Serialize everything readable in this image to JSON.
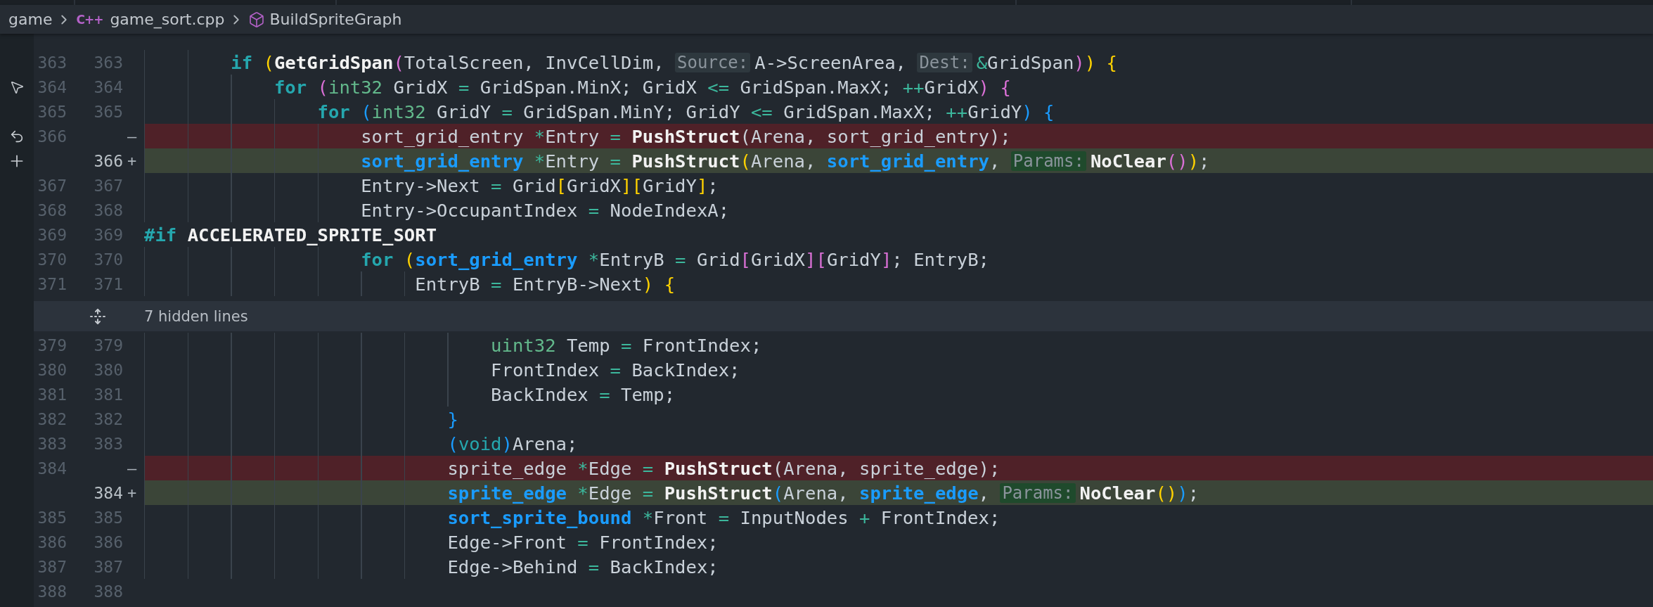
{
  "breadcrumb": [
    {
      "kind": "folder",
      "label": "game"
    },
    {
      "kind": "file",
      "icon_text": "C++",
      "label": "game_sort.cpp"
    },
    {
      "kind": "symbol",
      "label": "BuildSpriteGraph"
    }
  ],
  "rows": [
    {
      "kind": "line",
      "old": "363",
      "new": "363",
      "tokens": [
        {
          "kind": "control",
          "text": "        if "
        },
        {
          "kind": "b1",
          "text": "("
        },
        {
          "kind": "func",
          "text": "GetGridSpan"
        },
        {
          "kind": "b2",
          "text": "("
        },
        {
          "kind": "text",
          "text": "TotalScreen, InvCellDim, "
        },
        {
          "kind": "hint",
          "text": "Source:"
        },
        {
          "kind": "text",
          "text": "A->ScreenArea, "
        },
        {
          "kind": "hint",
          "text": "Dest:"
        },
        {
          "kind": "op",
          "text": "&"
        },
        {
          "kind": "text",
          "text": "GridSpan"
        },
        {
          "kind": "b2",
          "text": ")"
        },
        {
          "kind": "b1",
          "text": ") "
        },
        {
          "kind": "b1",
          "text": "{"
        }
      ]
    },
    {
      "kind": "line",
      "old": "364",
      "new": "364",
      "gutter": {
        "kind": "pointer"
      },
      "tokens": [
        {
          "kind": "control",
          "text": "            for "
        },
        {
          "kind": "b2",
          "text": "("
        },
        {
          "kind": "builtin",
          "text": "int32"
        },
        {
          "kind": "text",
          "text": " GridX "
        },
        {
          "kind": "op",
          "text": "="
        },
        {
          "kind": "text",
          "text": " GridSpan.MinX; GridX "
        },
        {
          "kind": "op",
          "text": "<="
        },
        {
          "kind": "text",
          "text": " GridSpan.MaxX; "
        },
        {
          "kind": "op",
          "text": "++"
        },
        {
          "kind": "text",
          "text": "GridX"
        },
        {
          "kind": "b2",
          "text": ") "
        },
        {
          "kind": "b2",
          "text": "{"
        }
      ]
    },
    {
      "kind": "line",
      "old": "365",
      "new": "365",
      "tokens": [
        {
          "kind": "control",
          "text": "                for "
        },
        {
          "kind": "b3",
          "text": "("
        },
        {
          "kind": "builtin",
          "text": "int32"
        },
        {
          "kind": "text",
          "text": " GridY "
        },
        {
          "kind": "op",
          "text": "="
        },
        {
          "kind": "text",
          "text": " GridSpan.MinY; GridY "
        },
        {
          "kind": "op",
          "text": "<="
        },
        {
          "kind": "text",
          "text": " GridSpan.MaxX; "
        },
        {
          "kind": "op",
          "text": "++"
        },
        {
          "kind": "text",
          "text": "GridY"
        },
        {
          "kind": "b3",
          "text": ") "
        },
        {
          "kind": "b3",
          "text": "{"
        }
      ]
    },
    {
      "kind": "removed",
      "old": "366",
      "marker": "—",
      "gutter": {
        "kind": "revert"
      },
      "tokens": [
        {
          "kind": "text",
          "text": "                    sort_grid_entry "
        },
        {
          "kind": "op",
          "text": "*"
        },
        {
          "kind": "text",
          "text": "Entry "
        },
        {
          "kind": "op",
          "text": "= "
        },
        {
          "kind": "func",
          "text": "PushStruct"
        },
        {
          "kind": "text",
          "text": "(Arena, sort_grid_entry);"
        }
      ]
    },
    {
      "kind": "added",
      "new": "366",
      "marker": "+",
      "gutter": {
        "kind": "stage"
      },
      "tokens": [
        {
          "kind": "type",
          "text": "                    sort_grid_entry "
        },
        {
          "kind": "op",
          "text": "*"
        },
        {
          "kind": "text",
          "text": "Entry "
        },
        {
          "kind": "op",
          "text": "= "
        },
        {
          "kind": "func",
          "text": "PushStruct"
        },
        {
          "kind": "b1",
          "text": "("
        },
        {
          "kind": "text",
          "text": "Arena, "
        },
        {
          "kind": "type",
          "text": "sort_grid_entry"
        },
        {
          "kind": "text",
          "text": ", "
        },
        {
          "kind": "hint",
          "text": "Params:"
        },
        {
          "kind": "func",
          "text": "NoClear"
        },
        {
          "kind": "b2",
          "text": "("
        },
        {
          "kind": "b2",
          "text": ")"
        },
        {
          "kind": "b1",
          "text": ")"
        },
        {
          "kind": "text",
          "text": ";"
        }
      ]
    },
    {
      "kind": "line",
      "old": "367",
      "new": "367",
      "tokens": [
        {
          "kind": "text",
          "text": "                    Entry->Next "
        },
        {
          "kind": "op",
          "text": "="
        },
        {
          "kind": "text",
          "text": " Grid"
        },
        {
          "kind": "b1",
          "text": "["
        },
        {
          "kind": "text",
          "text": "GridX"
        },
        {
          "kind": "b1",
          "text": "]"
        },
        {
          "kind": "b1",
          "text": "["
        },
        {
          "kind": "text",
          "text": "GridY"
        },
        {
          "kind": "b1",
          "text": "]"
        },
        {
          "kind": "text",
          "text": ";"
        }
      ]
    },
    {
      "kind": "line",
      "old": "368",
      "new": "368",
      "tokens": [
        {
          "kind": "text",
          "text": "                    Entry->OccupantIndex "
        },
        {
          "kind": "op",
          "text": "="
        },
        {
          "kind": "text",
          "text": " NodeIndexA;"
        }
      ]
    },
    {
      "kind": "line",
      "old": "369",
      "new": "369",
      "tokens": [
        {
          "kind": "control",
          "text": "#if "
        },
        {
          "kind": "macro",
          "text": "ACCELERATED_SPRITE_SORT"
        }
      ]
    },
    {
      "kind": "line",
      "old": "370",
      "new": "370",
      "tokens": [
        {
          "kind": "control",
          "text": "                    for "
        },
        {
          "kind": "b1",
          "text": "("
        },
        {
          "kind": "type",
          "text": "sort_grid_entry "
        },
        {
          "kind": "op",
          "text": "*"
        },
        {
          "kind": "text",
          "text": "EntryB "
        },
        {
          "kind": "op",
          "text": "="
        },
        {
          "kind": "text",
          "text": " Grid"
        },
        {
          "kind": "b2",
          "text": "["
        },
        {
          "kind": "text",
          "text": "GridX"
        },
        {
          "kind": "b2",
          "text": "]"
        },
        {
          "kind": "b2",
          "text": "["
        },
        {
          "kind": "text",
          "text": "GridY"
        },
        {
          "kind": "b2",
          "text": "]"
        },
        {
          "kind": "text",
          "text": "; EntryB;"
        }
      ]
    },
    {
      "kind": "line",
      "old": "371",
      "new": "371",
      "tokens": [
        {
          "kind": "text",
          "text": "                         EntryB "
        },
        {
          "kind": "op",
          "text": "="
        },
        {
          "kind": "text",
          "text": " EntryB->Next"
        },
        {
          "kind": "b1",
          "text": ") "
        },
        {
          "kind": "b1",
          "text": "{"
        }
      ]
    },
    {
      "kind": "fold",
      "label": "7 hidden lines"
    },
    {
      "kind": "line",
      "old": "379",
      "new": "379",
      "tokens": [
        {
          "kind": "builtin",
          "text": "                                uint32"
        },
        {
          "kind": "text",
          "text": " Temp "
        },
        {
          "kind": "op",
          "text": "="
        },
        {
          "kind": "text",
          "text": " FrontIndex;"
        }
      ]
    },
    {
      "kind": "line",
      "old": "380",
      "new": "380",
      "tokens": [
        {
          "kind": "text",
          "text": "                                FrontIndex "
        },
        {
          "kind": "op",
          "text": "="
        },
        {
          "kind": "text",
          "text": " BackIndex;"
        }
      ]
    },
    {
      "kind": "line",
      "old": "381",
      "new": "381",
      "tokens": [
        {
          "kind": "text",
          "text": "                                BackIndex "
        },
        {
          "kind": "op",
          "text": "="
        },
        {
          "kind": "text",
          "text": " Temp;"
        }
      ]
    },
    {
      "kind": "line",
      "old": "382",
      "new": "382",
      "tokens": [
        {
          "kind": "b3",
          "text": "                            }"
        }
      ]
    },
    {
      "kind": "line",
      "old": "383",
      "new": "383",
      "tokens": [
        {
          "kind": "b3",
          "text": "                            ("
        },
        {
          "kind": "keyword",
          "text": "void"
        },
        {
          "kind": "b3",
          "text": ")"
        },
        {
          "kind": "text",
          "text": "Arena;"
        }
      ]
    },
    {
      "kind": "removed",
      "old": "384",
      "marker": "—",
      "tokens": [
        {
          "kind": "text",
          "text": "                            sprite_edge "
        },
        {
          "kind": "op",
          "text": "*"
        },
        {
          "kind": "text",
          "text": "Edge "
        },
        {
          "kind": "op",
          "text": "= "
        },
        {
          "kind": "func",
          "text": "PushStruct"
        },
        {
          "kind": "text",
          "text": "(Arena, sprite_edge);"
        }
      ]
    },
    {
      "kind": "added",
      "new": "384",
      "marker": "+",
      "tokens": [
        {
          "kind": "type",
          "text": "                            sprite_edge "
        },
        {
          "kind": "op",
          "text": "*"
        },
        {
          "kind": "text",
          "text": "Edge "
        },
        {
          "kind": "op",
          "text": "= "
        },
        {
          "kind": "func",
          "text": "PushStruct"
        },
        {
          "kind": "b3",
          "text": "("
        },
        {
          "kind": "text",
          "text": "Arena, "
        },
        {
          "kind": "type",
          "text": "sprite_edge"
        },
        {
          "kind": "text",
          "text": ", "
        },
        {
          "kind": "hint",
          "text": "Params:"
        },
        {
          "kind": "func",
          "text": "NoClear"
        },
        {
          "kind": "b1",
          "text": "("
        },
        {
          "kind": "b1",
          "text": ")"
        },
        {
          "kind": "b3",
          "text": ")"
        },
        {
          "kind": "text",
          "text": ";"
        }
      ]
    },
    {
      "kind": "line",
      "old": "385",
      "new": "385",
      "tokens": [
        {
          "kind": "type",
          "text": "                            sort_sprite_bound "
        },
        {
          "kind": "op",
          "text": "*"
        },
        {
          "kind": "text",
          "text": "Front "
        },
        {
          "kind": "op",
          "text": "="
        },
        {
          "kind": "text",
          "text": " InputNodes "
        },
        {
          "kind": "op",
          "text": "+"
        },
        {
          "kind": "text",
          "text": " FrontIndex;"
        }
      ]
    },
    {
      "kind": "line",
      "old": "386",
      "new": "386",
      "tokens": [
        {
          "kind": "text",
          "text": "                            Edge->Front "
        },
        {
          "kind": "op",
          "text": "="
        },
        {
          "kind": "text",
          "text": " FrontIndex;"
        }
      ]
    },
    {
      "kind": "line",
      "old": "387",
      "new": "387",
      "tokens": [
        {
          "kind": "text",
          "text": "                            Edge->Behind "
        },
        {
          "kind": "op",
          "text": "="
        },
        {
          "kind": "text",
          "text": " BackIndex;"
        }
      ]
    },
    {
      "kind": "line",
      "old": "388",
      "new": "388"
    }
  ]
}
